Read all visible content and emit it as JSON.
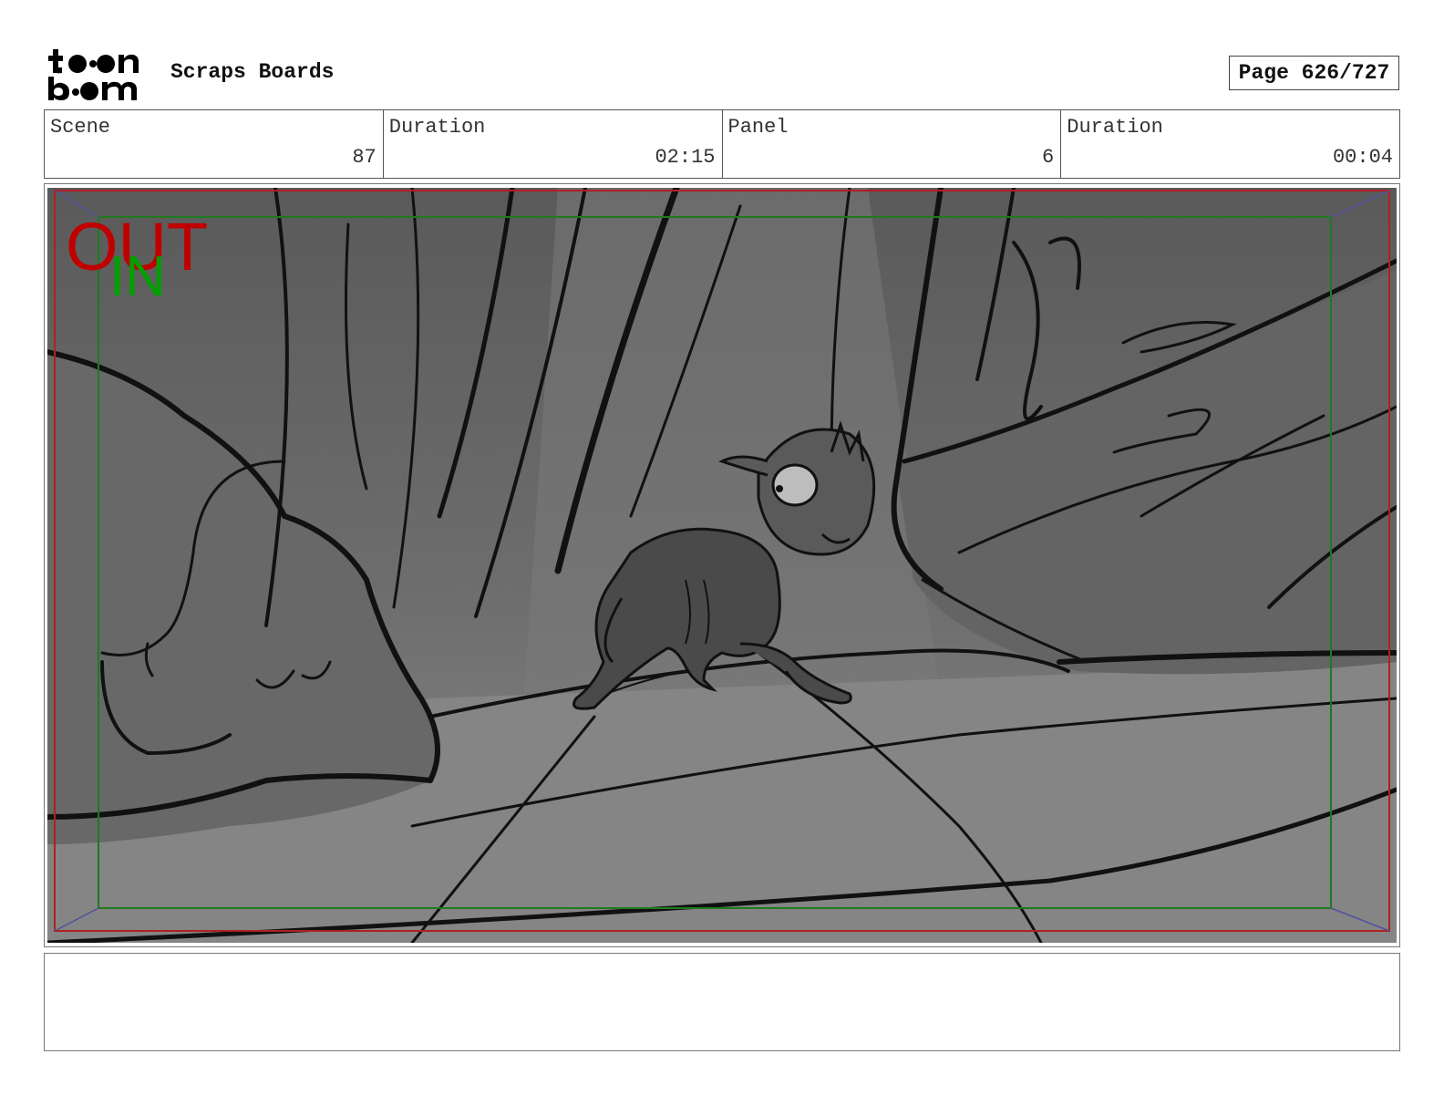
{
  "header": {
    "logo_text": "toon boom",
    "project_title": "Scraps Boards",
    "page_label": "Page 626/727"
  },
  "info": {
    "scene_label": "Scene",
    "scene_value": "87",
    "scene_duration_label": "Duration",
    "scene_duration_value": "02:15",
    "panel_label": "Panel",
    "panel_value": "6",
    "panel_duration_label": "Duration",
    "panel_duration_value": "00:04"
  },
  "panel": {
    "out_marker": "OUT",
    "in_marker": "IN",
    "out_color": "#c00000",
    "in_color": "#00a000",
    "safe_frame_color": "#1f7a1f",
    "out_frame_color": "#b02020"
  },
  "notes": {
    "text": ""
  }
}
